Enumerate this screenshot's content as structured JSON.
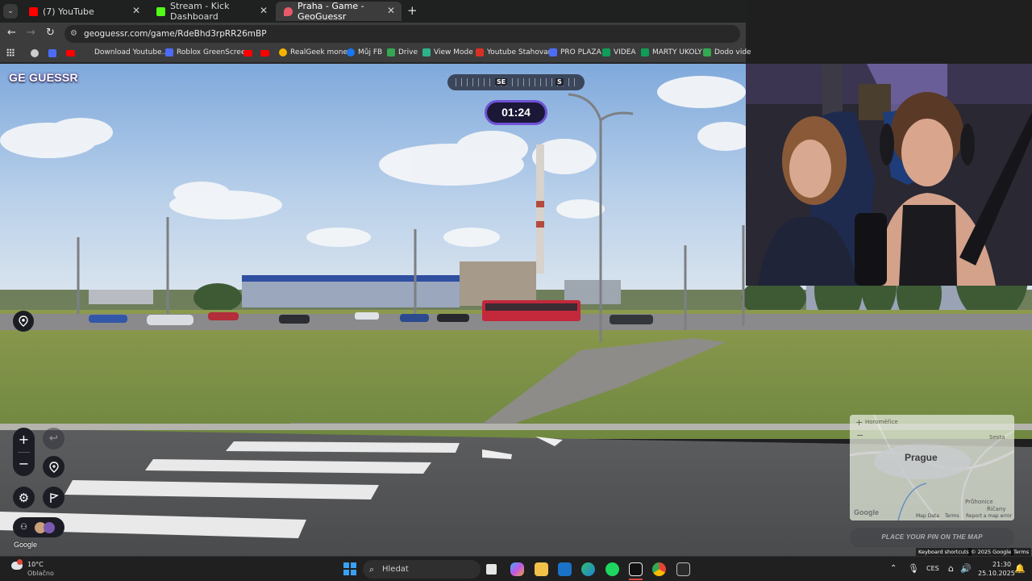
{
  "browser": {
    "tabs": [
      {
        "title": "(7) YouTube",
        "icon": "youtube-icon",
        "color": "#ff0000"
      },
      {
        "title": "Stream - Kick Dashboard",
        "icon": "kick-icon",
        "color": "#53fc18"
      },
      {
        "title": "Praha - Game - GeoGuessr",
        "icon": "map-pin-icon",
        "color": "#e85a6b"
      }
    ],
    "new_tab_symbol": "+",
    "close_symbol": "✕",
    "url": "geoguessr.com/game/RdeBhd3rpRR26mBP",
    "bookmarks": [
      {
        "label": "Download Youtube...",
        "color": "#ffffff"
      },
      {
        "label": "Roblox GreenScreen",
        "color": "#4a6cf7"
      },
      {
        "label": "RealGeek money",
        "color": "#f4b400"
      },
      {
        "label": "Můj FB",
        "color": "#1877f2"
      },
      {
        "label": "Drive",
        "color": "#34a853"
      },
      {
        "label": "View Mode",
        "color": "#2db38a"
      },
      {
        "label": "Youtube Stahovaní",
        "color": "#d93025"
      },
      {
        "label": "PRO PLAZA",
        "color": "#4a6cf7"
      },
      {
        "label": "VIDEA",
        "color": "#0f9d58"
      },
      {
        "label": "MARTY UKOLY",
        "color": "#0f9d58"
      },
      {
        "label": "Dodo vide",
        "color": "#34a853"
      }
    ]
  },
  "game": {
    "logo": "GE GUESSR",
    "compass": {
      "left": "SE",
      "right": "S"
    },
    "timer": "01:24",
    "zoom_in": "+",
    "zoom_out": "−",
    "map": {
      "city": "Prague",
      "labels": [
        "Horoměřice",
        "Sesta",
        "Průhonice",
        "Říčany"
      ],
      "footer": [
        "Map Data",
        "Terms",
        "Report a map error"
      ],
      "logo": "Google"
    },
    "place_pin": "PLACE YOUR PIN ON THE MAP",
    "street_credit": "Google",
    "credits": [
      "Keyboard shortcuts",
      "© 2025 Google",
      "Terms"
    ]
  },
  "taskbar": {
    "weather_temp": "10°C",
    "weather_text": "Oblačno",
    "search_placeholder": "Hledat",
    "language": "CES",
    "time": "21:30",
    "date": "25.10.2025"
  },
  "colors": {
    "timer_border": "#6e52d6",
    "accent_purple": "#7a4fd9"
  }
}
